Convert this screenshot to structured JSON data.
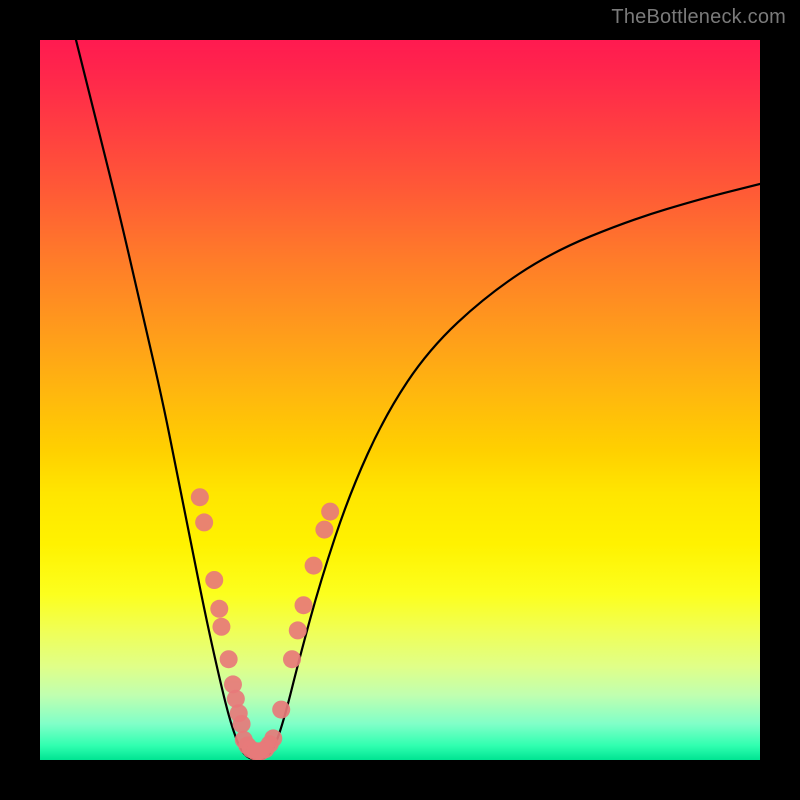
{
  "watermark": {
    "text": "TheBottleneck.com"
  },
  "chart_data": {
    "type": "line",
    "title": "",
    "xlabel": "",
    "ylabel": "",
    "xlim": [
      0,
      100
    ],
    "ylim": [
      0,
      100
    ],
    "grid": false,
    "legend": false,
    "background_gradient": {
      "stops": [
        {
          "pos": 0,
          "color": "#ff1a50"
        },
        {
          "pos": 40,
          "color": "#ff9a1c"
        },
        {
          "pos": 63,
          "color": "#ffe600"
        },
        {
          "pos": 88,
          "color": "#d0ff90"
        },
        {
          "pos": 100,
          "color": "#00e492"
        }
      ]
    },
    "series": [
      {
        "name": "bottleneck-curve",
        "color": "#000000",
        "type": "line",
        "points": [
          {
            "x": 5.0,
            "y": 100.0
          },
          {
            "x": 8.0,
            "y": 88.0
          },
          {
            "x": 11.0,
            "y": 76.0
          },
          {
            "x": 14.0,
            "y": 63.0
          },
          {
            "x": 17.0,
            "y": 50.0
          },
          {
            "x": 19.0,
            "y": 40.0
          },
          {
            "x": 21.0,
            "y": 30.0
          },
          {
            "x": 23.0,
            "y": 20.0
          },
          {
            "x": 25.0,
            "y": 11.0
          },
          {
            "x": 26.5,
            "y": 5.0
          },
          {
            "x": 28.0,
            "y": 1.0
          },
          {
            "x": 29.5,
            "y": 0.0
          },
          {
            "x": 31.0,
            "y": 0.0
          },
          {
            "x": 32.5,
            "y": 1.5
          },
          {
            "x": 34.0,
            "y": 6.0
          },
          {
            "x": 36.0,
            "y": 14.0
          },
          {
            "x": 39.0,
            "y": 25.0
          },
          {
            "x": 43.0,
            "y": 37.0
          },
          {
            "x": 48.0,
            "y": 48.0
          },
          {
            "x": 54.0,
            "y": 57.0
          },
          {
            "x": 62.0,
            "y": 64.5
          },
          {
            "x": 71.0,
            "y": 70.5
          },
          {
            "x": 82.0,
            "y": 75.0
          },
          {
            "x": 92.0,
            "y": 78.0
          },
          {
            "x": 100.0,
            "y": 80.0
          }
        ]
      },
      {
        "name": "markers-left",
        "color": "#e77a7a",
        "type": "scatter",
        "points": [
          {
            "x": 22.2,
            "y": 36.5
          },
          {
            "x": 22.8,
            "y": 33.0
          },
          {
            "x": 24.2,
            "y": 25.0
          },
          {
            "x": 24.9,
            "y": 21.0
          },
          {
            "x": 25.2,
            "y": 18.5
          },
          {
            "x": 26.2,
            "y": 14.0
          },
          {
            "x": 26.8,
            "y": 10.5
          },
          {
            "x": 27.2,
            "y": 8.5
          },
          {
            "x": 27.6,
            "y": 6.5
          },
          {
            "x": 28.0,
            "y": 5.0
          }
        ]
      },
      {
        "name": "markers-bottom",
        "color": "#e77a7a",
        "type": "scatter",
        "points": [
          {
            "x": 28.3,
            "y": 2.8
          },
          {
            "x": 28.8,
            "y": 2.0
          },
          {
            "x": 29.3,
            "y": 1.5
          },
          {
            "x": 29.9,
            "y": 1.2
          },
          {
            "x": 30.3,
            "y": 1.2
          },
          {
            "x": 30.7,
            "y": 1.2
          },
          {
            "x": 31.3,
            "y": 1.5
          },
          {
            "x": 31.9,
            "y": 2.2
          },
          {
            "x": 32.4,
            "y": 3.0
          }
        ]
      },
      {
        "name": "markers-right",
        "color": "#e77a7a",
        "type": "scatter",
        "points": [
          {
            "x": 33.5,
            "y": 7.0
          },
          {
            "x": 35.0,
            "y": 14.0
          },
          {
            "x": 35.8,
            "y": 18.0
          },
          {
            "x": 36.6,
            "y": 21.5
          },
          {
            "x": 38.0,
            "y": 27.0
          },
          {
            "x": 39.5,
            "y": 32.0
          },
          {
            "x": 40.3,
            "y": 34.5
          }
        ]
      }
    ]
  }
}
